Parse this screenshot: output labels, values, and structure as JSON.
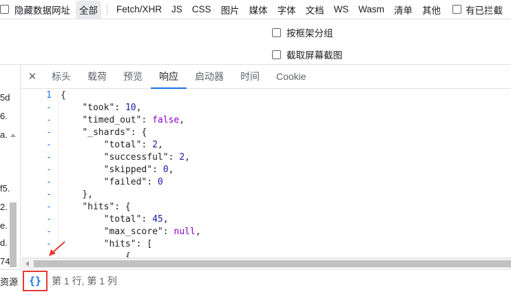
{
  "filter_bar": {
    "hide_data_urls": "隐藏数据网址",
    "types": [
      "全部",
      "Fetch/XHR",
      "JS",
      "CSS",
      "图片",
      "媒体",
      "字体",
      "文档",
      "WS",
      "Wasm",
      "清单",
      "其他"
    ],
    "active_type": "全部",
    "blocked_cookies": "有已拦截"
  },
  "options": {
    "group_by_frame": "按框架分组",
    "capture_screenshots": "截取屏幕截图"
  },
  "left_list": {
    "items": [
      "5d",
      "6.",
      "a.",
      "f5.",
      "2.",
      "e.",
      "d.",
      "74"
    ]
  },
  "tabs": [
    "标头",
    "载荷",
    "预览",
    "响应",
    "启动器",
    "时间",
    "Cookie"
  ],
  "active_tab": "响应",
  "code": {
    "gutter": [
      "1",
      "-",
      "-",
      "-",
      "-",
      "-",
      "-",
      "-",
      "-",
      "-",
      "-",
      "-",
      "-"
    ],
    "lines": [
      {
        "indent": "",
        "key": "{",
        "sep": "",
        "val": "",
        "vtype": "",
        "tail": ""
      },
      {
        "indent": "    ",
        "key": "\"took\"",
        "sep": ": ",
        "val": "10",
        "vtype": "n",
        "tail": ","
      },
      {
        "indent": "    ",
        "key": "\"timed_out\"",
        "sep": ": ",
        "val": "false",
        "vtype": "lit",
        "tail": ","
      },
      {
        "indent": "    ",
        "key": "\"_shards\"",
        "sep": ": {",
        "val": "",
        "vtype": "",
        "tail": ""
      },
      {
        "indent": "        ",
        "key": "\"total\"",
        "sep": ": ",
        "val": "2",
        "vtype": "n",
        "tail": ","
      },
      {
        "indent": "        ",
        "key": "\"successful\"",
        "sep": ": ",
        "val": "2",
        "vtype": "n",
        "tail": ","
      },
      {
        "indent": "        ",
        "key": "\"skipped\"",
        "sep": ": ",
        "val": "0",
        "vtype": "n",
        "tail": ","
      },
      {
        "indent": "        ",
        "key": "\"failed\"",
        "sep": ": ",
        "val": "0",
        "vtype": "n",
        "tail": ""
      },
      {
        "indent": "    ",
        "key": "},",
        "sep": "",
        "val": "",
        "vtype": "",
        "tail": ""
      },
      {
        "indent": "    ",
        "key": "\"hits\"",
        "sep": ": {",
        "val": "",
        "vtype": "",
        "tail": ""
      },
      {
        "indent": "        ",
        "key": "\"total\"",
        "sep": ": ",
        "val": "45",
        "vtype": "n",
        "tail": ","
      },
      {
        "indent": "        ",
        "key": "\"max_score\"",
        "sep": ": ",
        "val": "null",
        "vtype": "lit",
        "tail": ","
      },
      {
        "indent": "        ",
        "key": "\"hits\"",
        "sep": ": [",
        "val": "",
        "vtype": "",
        "tail": ""
      },
      {
        "indent": "            ",
        "key": "{",
        "sep": "",
        "val": "",
        "vtype": "",
        "tail": ""
      }
    ]
  },
  "status": {
    "resources": "资源",
    "pretty_print": "{}",
    "cursor_position": "第 1 行, 第 1 列"
  },
  "colors": {
    "accent": "#1a73e8",
    "highlight_box": "#e53935",
    "arrow": "#e53935"
  },
  "icons": {
    "close": "close-icon",
    "pretty_print": "pretty-print-icon",
    "arrow": "annotation-arrow-icon"
  }
}
